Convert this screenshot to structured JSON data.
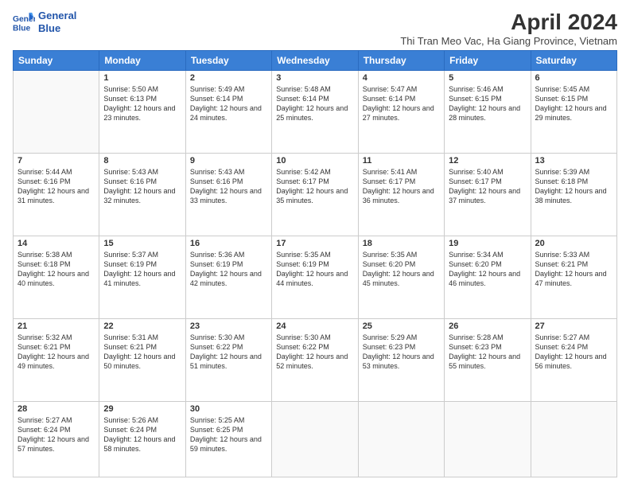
{
  "logo": {
    "line1": "General",
    "line2": "Blue"
  },
  "title": "April 2024",
  "subtitle": "Thi Tran Meo Vac, Ha Giang Province, Vietnam",
  "days_of_week": [
    "Sunday",
    "Monday",
    "Tuesday",
    "Wednesday",
    "Thursday",
    "Friday",
    "Saturday"
  ],
  "weeks": [
    [
      {
        "day": "",
        "sunrise": "",
        "sunset": "",
        "daylight": ""
      },
      {
        "day": "1",
        "sunrise": "Sunrise: 5:50 AM",
        "sunset": "Sunset: 6:13 PM",
        "daylight": "Daylight: 12 hours and 23 minutes."
      },
      {
        "day": "2",
        "sunrise": "Sunrise: 5:49 AM",
        "sunset": "Sunset: 6:14 PM",
        "daylight": "Daylight: 12 hours and 24 minutes."
      },
      {
        "day": "3",
        "sunrise": "Sunrise: 5:48 AM",
        "sunset": "Sunset: 6:14 PM",
        "daylight": "Daylight: 12 hours and 25 minutes."
      },
      {
        "day": "4",
        "sunrise": "Sunrise: 5:47 AM",
        "sunset": "Sunset: 6:14 PM",
        "daylight": "Daylight: 12 hours and 27 minutes."
      },
      {
        "day": "5",
        "sunrise": "Sunrise: 5:46 AM",
        "sunset": "Sunset: 6:15 PM",
        "daylight": "Daylight: 12 hours and 28 minutes."
      },
      {
        "day": "6",
        "sunrise": "Sunrise: 5:45 AM",
        "sunset": "Sunset: 6:15 PM",
        "daylight": "Daylight: 12 hours and 29 minutes."
      }
    ],
    [
      {
        "day": "7",
        "sunrise": "Sunrise: 5:44 AM",
        "sunset": "Sunset: 6:16 PM",
        "daylight": "Daylight: 12 hours and 31 minutes."
      },
      {
        "day": "8",
        "sunrise": "Sunrise: 5:43 AM",
        "sunset": "Sunset: 6:16 PM",
        "daylight": "Daylight: 12 hours and 32 minutes."
      },
      {
        "day": "9",
        "sunrise": "Sunrise: 5:43 AM",
        "sunset": "Sunset: 6:16 PM",
        "daylight": "Daylight: 12 hours and 33 minutes."
      },
      {
        "day": "10",
        "sunrise": "Sunrise: 5:42 AM",
        "sunset": "Sunset: 6:17 PM",
        "daylight": "Daylight: 12 hours and 35 minutes."
      },
      {
        "day": "11",
        "sunrise": "Sunrise: 5:41 AM",
        "sunset": "Sunset: 6:17 PM",
        "daylight": "Daylight: 12 hours and 36 minutes."
      },
      {
        "day": "12",
        "sunrise": "Sunrise: 5:40 AM",
        "sunset": "Sunset: 6:17 PM",
        "daylight": "Daylight: 12 hours and 37 minutes."
      },
      {
        "day": "13",
        "sunrise": "Sunrise: 5:39 AM",
        "sunset": "Sunset: 6:18 PM",
        "daylight": "Daylight: 12 hours and 38 minutes."
      }
    ],
    [
      {
        "day": "14",
        "sunrise": "Sunrise: 5:38 AM",
        "sunset": "Sunset: 6:18 PM",
        "daylight": "Daylight: 12 hours and 40 minutes."
      },
      {
        "day": "15",
        "sunrise": "Sunrise: 5:37 AM",
        "sunset": "Sunset: 6:19 PM",
        "daylight": "Daylight: 12 hours and 41 minutes."
      },
      {
        "day": "16",
        "sunrise": "Sunrise: 5:36 AM",
        "sunset": "Sunset: 6:19 PM",
        "daylight": "Daylight: 12 hours and 42 minutes."
      },
      {
        "day": "17",
        "sunrise": "Sunrise: 5:35 AM",
        "sunset": "Sunset: 6:19 PM",
        "daylight": "Daylight: 12 hours and 44 minutes."
      },
      {
        "day": "18",
        "sunrise": "Sunrise: 5:35 AM",
        "sunset": "Sunset: 6:20 PM",
        "daylight": "Daylight: 12 hours and 45 minutes."
      },
      {
        "day": "19",
        "sunrise": "Sunrise: 5:34 AM",
        "sunset": "Sunset: 6:20 PM",
        "daylight": "Daylight: 12 hours and 46 minutes."
      },
      {
        "day": "20",
        "sunrise": "Sunrise: 5:33 AM",
        "sunset": "Sunset: 6:21 PM",
        "daylight": "Daylight: 12 hours and 47 minutes."
      }
    ],
    [
      {
        "day": "21",
        "sunrise": "Sunrise: 5:32 AM",
        "sunset": "Sunset: 6:21 PM",
        "daylight": "Daylight: 12 hours and 49 minutes."
      },
      {
        "day": "22",
        "sunrise": "Sunrise: 5:31 AM",
        "sunset": "Sunset: 6:21 PM",
        "daylight": "Daylight: 12 hours and 50 minutes."
      },
      {
        "day": "23",
        "sunrise": "Sunrise: 5:30 AM",
        "sunset": "Sunset: 6:22 PM",
        "daylight": "Daylight: 12 hours and 51 minutes."
      },
      {
        "day": "24",
        "sunrise": "Sunrise: 5:30 AM",
        "sunset": "Sunset: 6:22 PM",
        "daylight": "Daylight: 12 hours and 52 minutes."
      },
      {
        "day": "25",
        "sunrise": "Sunrise: 5:29 AM",
        "sunset": "Sunset: 6:23 PM",
        "daylight": "Daylight: 12 hours and 53 minutes."
      },
      {
        "day": "26",
        "sunrise": "Sunrise: 5:28 AM",
        "sunset": "Sunset: 6:23 PM",
        "daylight": "Daylight: 12 hours and 55 minutes."
      },
      {
        "day": "27",
        "sunrise": "Sunrise: 5:27 AM",
        "sunset": "Sunset: 6:24 PM",
        "daylight": "Daylight: 12 hours and 56 minutes."
      }
    ],
    [
      {
        "day": "28",
        "sunrise": "Sunrise: 5:27 AM",
        "sunset": "Sunset: 6:24 PM",
        "daylight": "Daylight: 12 hours and 57 minutes."
      },
      {
        "day": "29",
        "sunrise": "Sunrise: 5:26 AM",
        "sunset": "Sunset: 6:24 PM",
        "daylight": "Daylight: 12 hours and 58 minutes."
      },
      {
        "day": "30",
        "sunrise": "Sunrise: 5:25 AM",
        "sunset": "Sunset: 6:25 PM",
        "daylight": "Daylight: 12 hours and 59 minutes."
      },
      {
        "day": "",
        "sunrise": "",
        "sunset": "",
        "daylight": ""
      },
      {
        "day": "",
        "sunrise": "",
        "sunset": "",
        "daylight": ""
      },
      {
        "day": "",
        "sunrise": "",
        "sunset": "",
        "daylight": ""
      },
      {
        "day": "",
        "sunrise": "",
        "sunset": "",
        "daylight": ""
      }
    ]
  ]
}
